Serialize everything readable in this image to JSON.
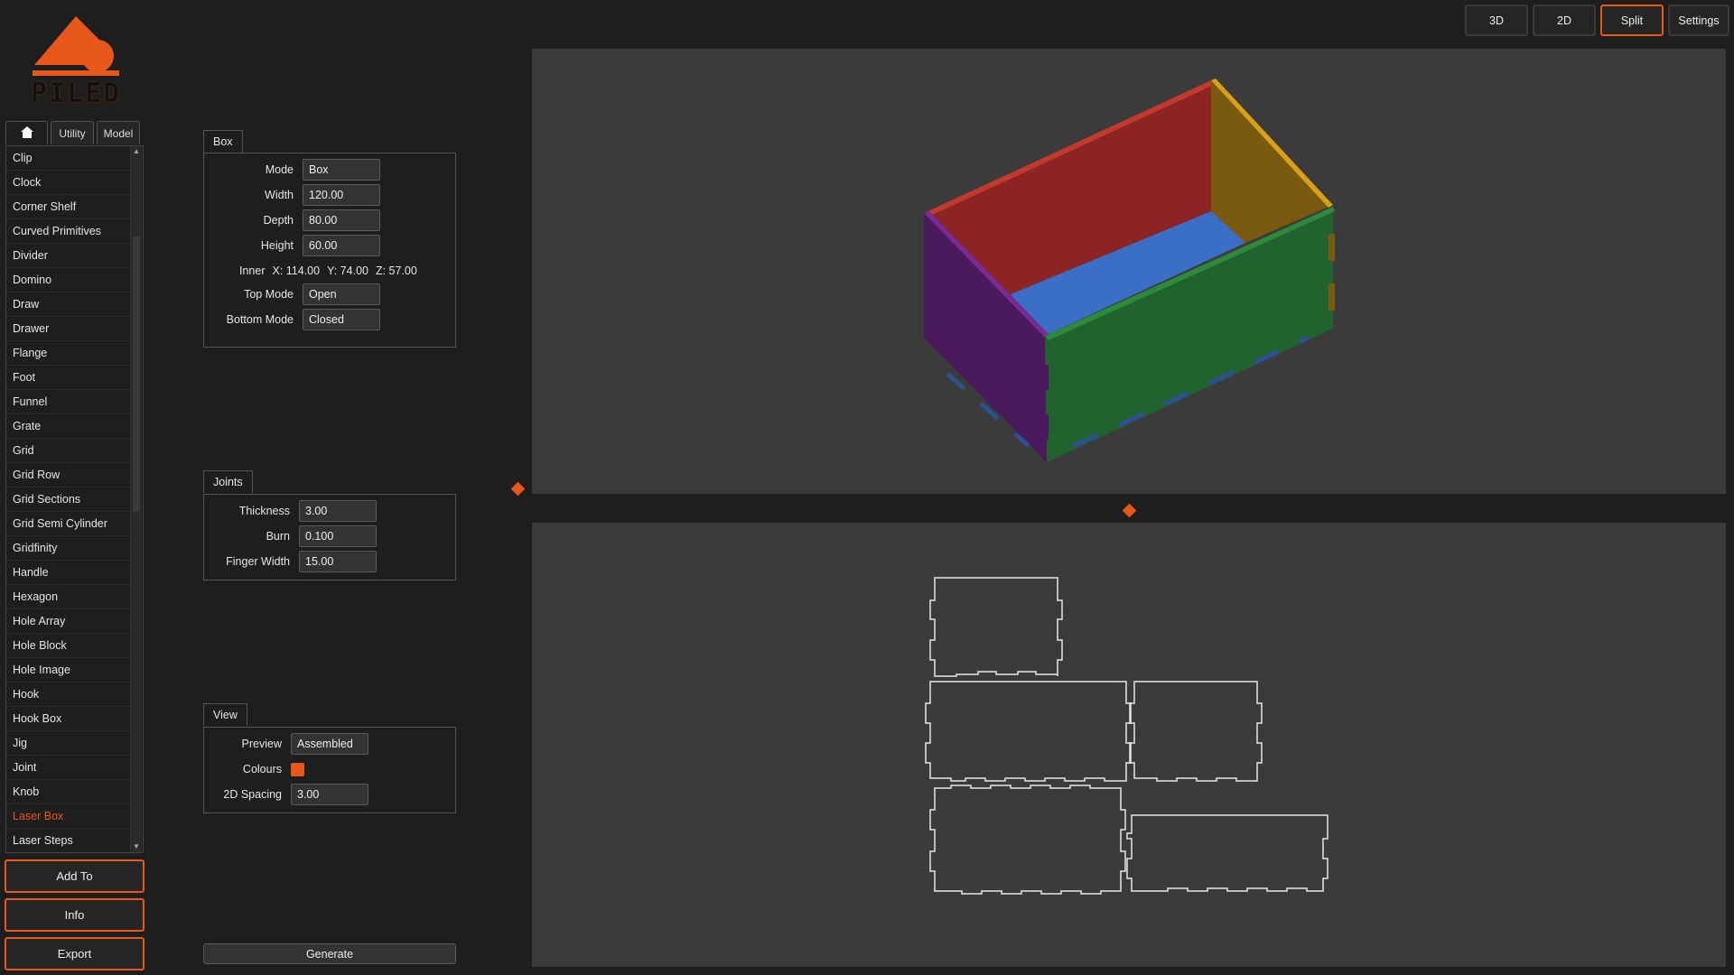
{
  "app": {
    "logo_text": "PILED"
  },
  "colors": {
    "accent": "#e8581a",
    "panel": "#3b3b3b",
    "background": "#1e1e1e"
  },
  "view_buttons": [
    {
      "label": "3D",
      "active": false
    },
    {
      "label": "2D",
      "active": false
    },
    {
      "label": "Split",
      "active": true
    },
    {
      "label": "Settings",
      "active": false
    }
  ],
  "tabs": {
    "home_icon": "home-icon",
    "utility": "Utility",
    "model": "Model"
  },
  "tool_list": {
    "items": [
      "Clip",
      "Clock",
      "Corner Shelf",
      "Curved Primitives",
      "Divider",
      "Domino",
      "Draw",
      "Drawer",
      "Flange",
      "Foot",
      "Funnel",
      "Grate",
      "Grid",
      "Grid Row",
      "Grid Sections",
      "Grid Semi Cylinder",
      "Gridfinity",
      "Handle",
      "Hexagon",
      "Hole Array",
      "Hole Block",
      "Hole Image",
      "Hook",
      "Hook Box",
      "Jig",
      "Joint",
      "Knob",
      "Laser Box",
      "Laser Steps"
    ],
    "selected": "Laser Box"
  },
  "side_buttons": {
    "add_to": "Add To",
    "info": "Info",
    "export": "Export"
  },
  "box_panel": {
    "title": "Box",
    "mode_label": "Mode",
    "mode_value": "Box",
    "width_label": "Width",
    "width_value": "120.00",
    "depth_label": "Depth",
    "depth_value": "80.00",
    "height_label": "Height",
    "height_value": "60.00",
    "inner_label": "Inner",
    "inner_x": "X: 114.00",
    "inner_y": "Y: 74.00",
    "inner_z": "Z: 57.00",
    "top_mode_label": "Top Mode",
    "top_mode_value": "Open",
    "bottom_mode_label": "Bottom Mode",
    "bottom_mode_value": "Closed"
  },
  "joints_panel": {
    "title": "Joints",
    "thickness_label": "Thickness",
    "thickness_value": "3.00",
    "burn_label": "Burn",
    "burn_value": "0.100",
    "finger_width_label": "Finger Width",
    "finger_width_value": "15.00"
  },
  "view_panel": {
    "title": "View",
    "preview_label": "Preview",
    "preview_value": "Assembled",
    "colours_label": "Colours",
    "colours_value": "#e8581a",
    "spacing_label": "2D Spacing",
    "spacing_value": "3.00"
  },
  "generate_label": "Generate"
}
